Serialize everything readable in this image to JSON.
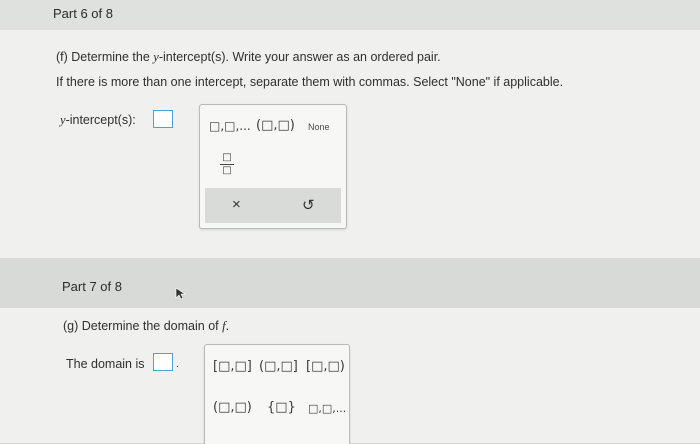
{
  "part6": {
    "header": "Part 6 of 8",
    "question": "(f) Determine the y-intercept(s). Write your answer as an ordered pair.",
    "question_pre": "(f) Determine the ",
    "question_var": "y",
    "question_post": "-intercept(s). Write your answer as an ordered pair.",
    "instruction": "If there is more than one intercept, separate them with commas. Select \"None\" if applicable.",
    "label_var": "y",
    "label_post": "-intercept(s):",
    "palette": {
      "list_symbol": "□,□,...",
      "pair_symbol": "(□,□)",
      "none_label": "None",
      "fraction_top": "□",
      "fraction_bottom": "□",
      "clear_icon": "×",
      "undo_icon": "↺"
    }
  },
  "part7": {
    "header": "Part 7 of 8",
    "question_pre": "(g) Determine the domain of ",
    "question_var": "f",
    "question_post": ".",
    "label": "The domain is",
    "palette": {
      "row1": [
        "[□,□]",
        "(□,□]",
        "[□,□)"
      ],
      "row2": [
        "(□,□)",
        "{□}",
        "□,□,..."
      ]
    }
  },
  "colors": {
    "answer_border": "#4aa3d8",
    "panel_bg": "#f0f1ee",
    "header_bg": "#dfe1de"
  }
}
